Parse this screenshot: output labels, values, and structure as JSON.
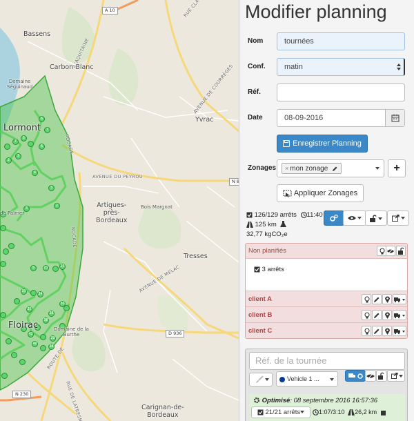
{
  "map": {
    "places": {
      "bassens": "Bassens",
      "carbon_blanc": "Carbon-Blanc",
      "domaine_seguinaud": "Domaine\nSéguinaud",
      "lormont": "Lormont",
      "yvrac": "Yvrac",
      "artigues": "Artigues-\nprès-\nBordeaux",
      "bois_margnat": "Bois Margnat",
      "tresses": "Tresses",
      "de_palmer": "de Palmer",
      "floirac": "Floirac",
      "domaine_burthe": "Domaine de la\nBurthe",
      "carignan": "Carignan-de-\nBordeaux"
    },
    "roads": {
      "a10": "A 10",
      "n230": "N 230",
      "d936": "D 936",
      "n8": "N 8",
      "avenue_peyrou": "AVENUE DU PEYROU",
      "avenue_melac": "AVENUE DE MELAC",
      "aquitaine": "L'AQUITAINE",
      "avenue_courrèges": "AVENUE DE COURRÈGES",
      "rocade": "ROCADE",
      "rocade2": "ROCADE",
      "rue_cla": "RUE CLA",
      "rue_latresne": "RUE DE LATRESNE",
      "route_de": "ROUTE DE"
    }
  },
  "panel": {
    "title": "Modifier planning",
    "form": {
      "nom_label": "Nom",
      "nom_value": "tournées",
      "conf_label": "Conf.",
      "conf_value": "matin",
      "ref_label": "Réf.",
      "ref_value": "",
      "date_label": "Date",
      "date_value": "08-09-2016",
      "save_label": "Enregistrer Planning",
      "zonages_label": "Zonages",
      "zonage_tag": "mon zonage",
      "apply_zonages_label": "Appliquer Zonages"
    },
    "stats": {
      "stops": "126/129 arrêts",
      "time": "11:40",
      "distance": "125 km",
      "co2": "32,77 kgCO₂e"
    },
    "unplanned": {
      "title": "Non planifiés",
      "stops_count": "3 arrêts",
      "clients": [
        "client A",
        "client B",
        "client C"
      ]
    },
    "tour": {
      "ref_placeholder": "Réf. de la tournée",
      "vehicle": "Vehicle 1 ...",
      "optimized_label": "Optimisé",
      "optimized_date": ": 08 septembre 2016 16:57:36",
      "stops": "21/21 arrêts",
      "time": "1:07/3:10",
      "distance": "26,2 km"
    },
    "colors": {
      "primary": "#3a88c8",
      "danger_bg": "#f2dede",
      "danger_text": "#a94442",
      "success_bg": "#dff0d8",
      "highlight": "#e00000",
      "zone": "#4cc44c"
    }
  }
}
